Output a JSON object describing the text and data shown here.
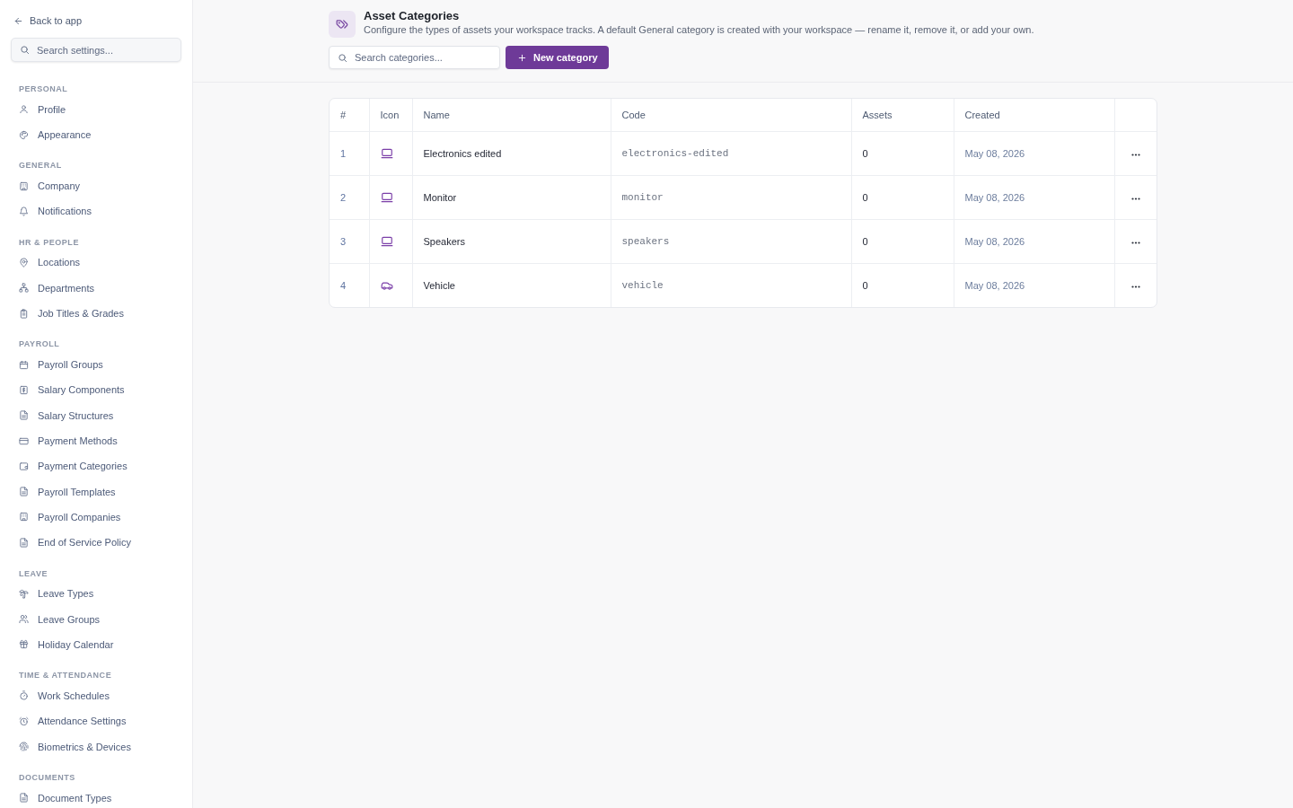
{
  "sidebar": {
    "back_link": "Back to app",
    "search": {
      "placeholder": "Search settings..."
    },
    "sections": [
      {
        "title": "PERSONAL",
        "items": [
          {
            "label": "Profile"
          },
          {
            "label": "Appearance"
          }
        ]
      },
      {
        "title": "GENERAL",
        "items": [
          {
            "label": "Company"
          },
          {
            "label": "Notifications"
          }
        ]
      },
      {
        "title": "HR & PEOPLE",
        "items": [
          {
            "label": "Locations"
          },
          {
            "label": "Departments"
          },
          {
            "label": "Job Titles & Grades"
          }
        ]
      },
      {
        "title": "PAYROLL",
        "items": [
          {
            "label": "Payroll Groups"
          },
          {
            "label": "Salary Components"
          },
          {
            "label": "Salary Structures"
          },
          {
            "label": "Payment Methods"
          },
          {
            "label": "Payment Categories"
          },
          {
            "label": "Payroll Templates"
          },
          {
            "label": "Payroll Companies"
          },
          {
            "label": "End of Service Policy"
          }
        ]
      },
      {
        "title": "LEAVE",
        "items": [
          {
            "label": "Leave Types"
          },
          {
            "label": "Leave Groups"
          },
          {
            "label": "Holiday Calendar"
          }
        ]
      },
      {
        "title": "TIME & ATTENDANCE",
        "items": [
          {
            "label": "Work Schedules"
          },
          {
            "label": "Attendance Settings"
          },
          {
            "label": "Biometrics & Devices"
          }
        ]
      },
      {
        "title": "DOCUMENTS",
        "items": [
          {
            "label": "Document Types"
          }
        ]
      }
    ]
  },
  "header": {
    "title": "Asset Categories",
    "description": "Configure the types of assets your workspace tracks. A default General category is created with your workspace — rename it, remove it, or add your own.",
    "search": {
      "placeholder": "Search categories..."
    },
    "new_button": "New category"
  },
  "table": {
    "columns": [
      "#",
      "Icon",
      "Name",
      "Code",
      "Assets",
      "Created"
    ],
    "rows": [
      {
        "number": "1",
        "kind": "device",
        "name": "Electronics edited",
        "code": "electronics-edited",
        "assets": "0",
        "created": "May 08, 2026"
      },
      {
        "number": "2",
        "kind": "device",
        "name": "Monitor",
        "code": "monitor",
        "assets": "0",
        "created": "May 08, 2026"
      },
      {
        "number": "3",
        "kind": "device",
        "name": "Speakers",
        "code": "speakers",
        "assets": "0",
        "created": "May 08, 2026"
      },
      {
        "number": "4",
        "kind": "vehicle",
        "name": "Vehicle",
        "code": "vehicle",
        "assets": "0",
        "created": "May 08, 2026"
      }
    ]
  }
}
